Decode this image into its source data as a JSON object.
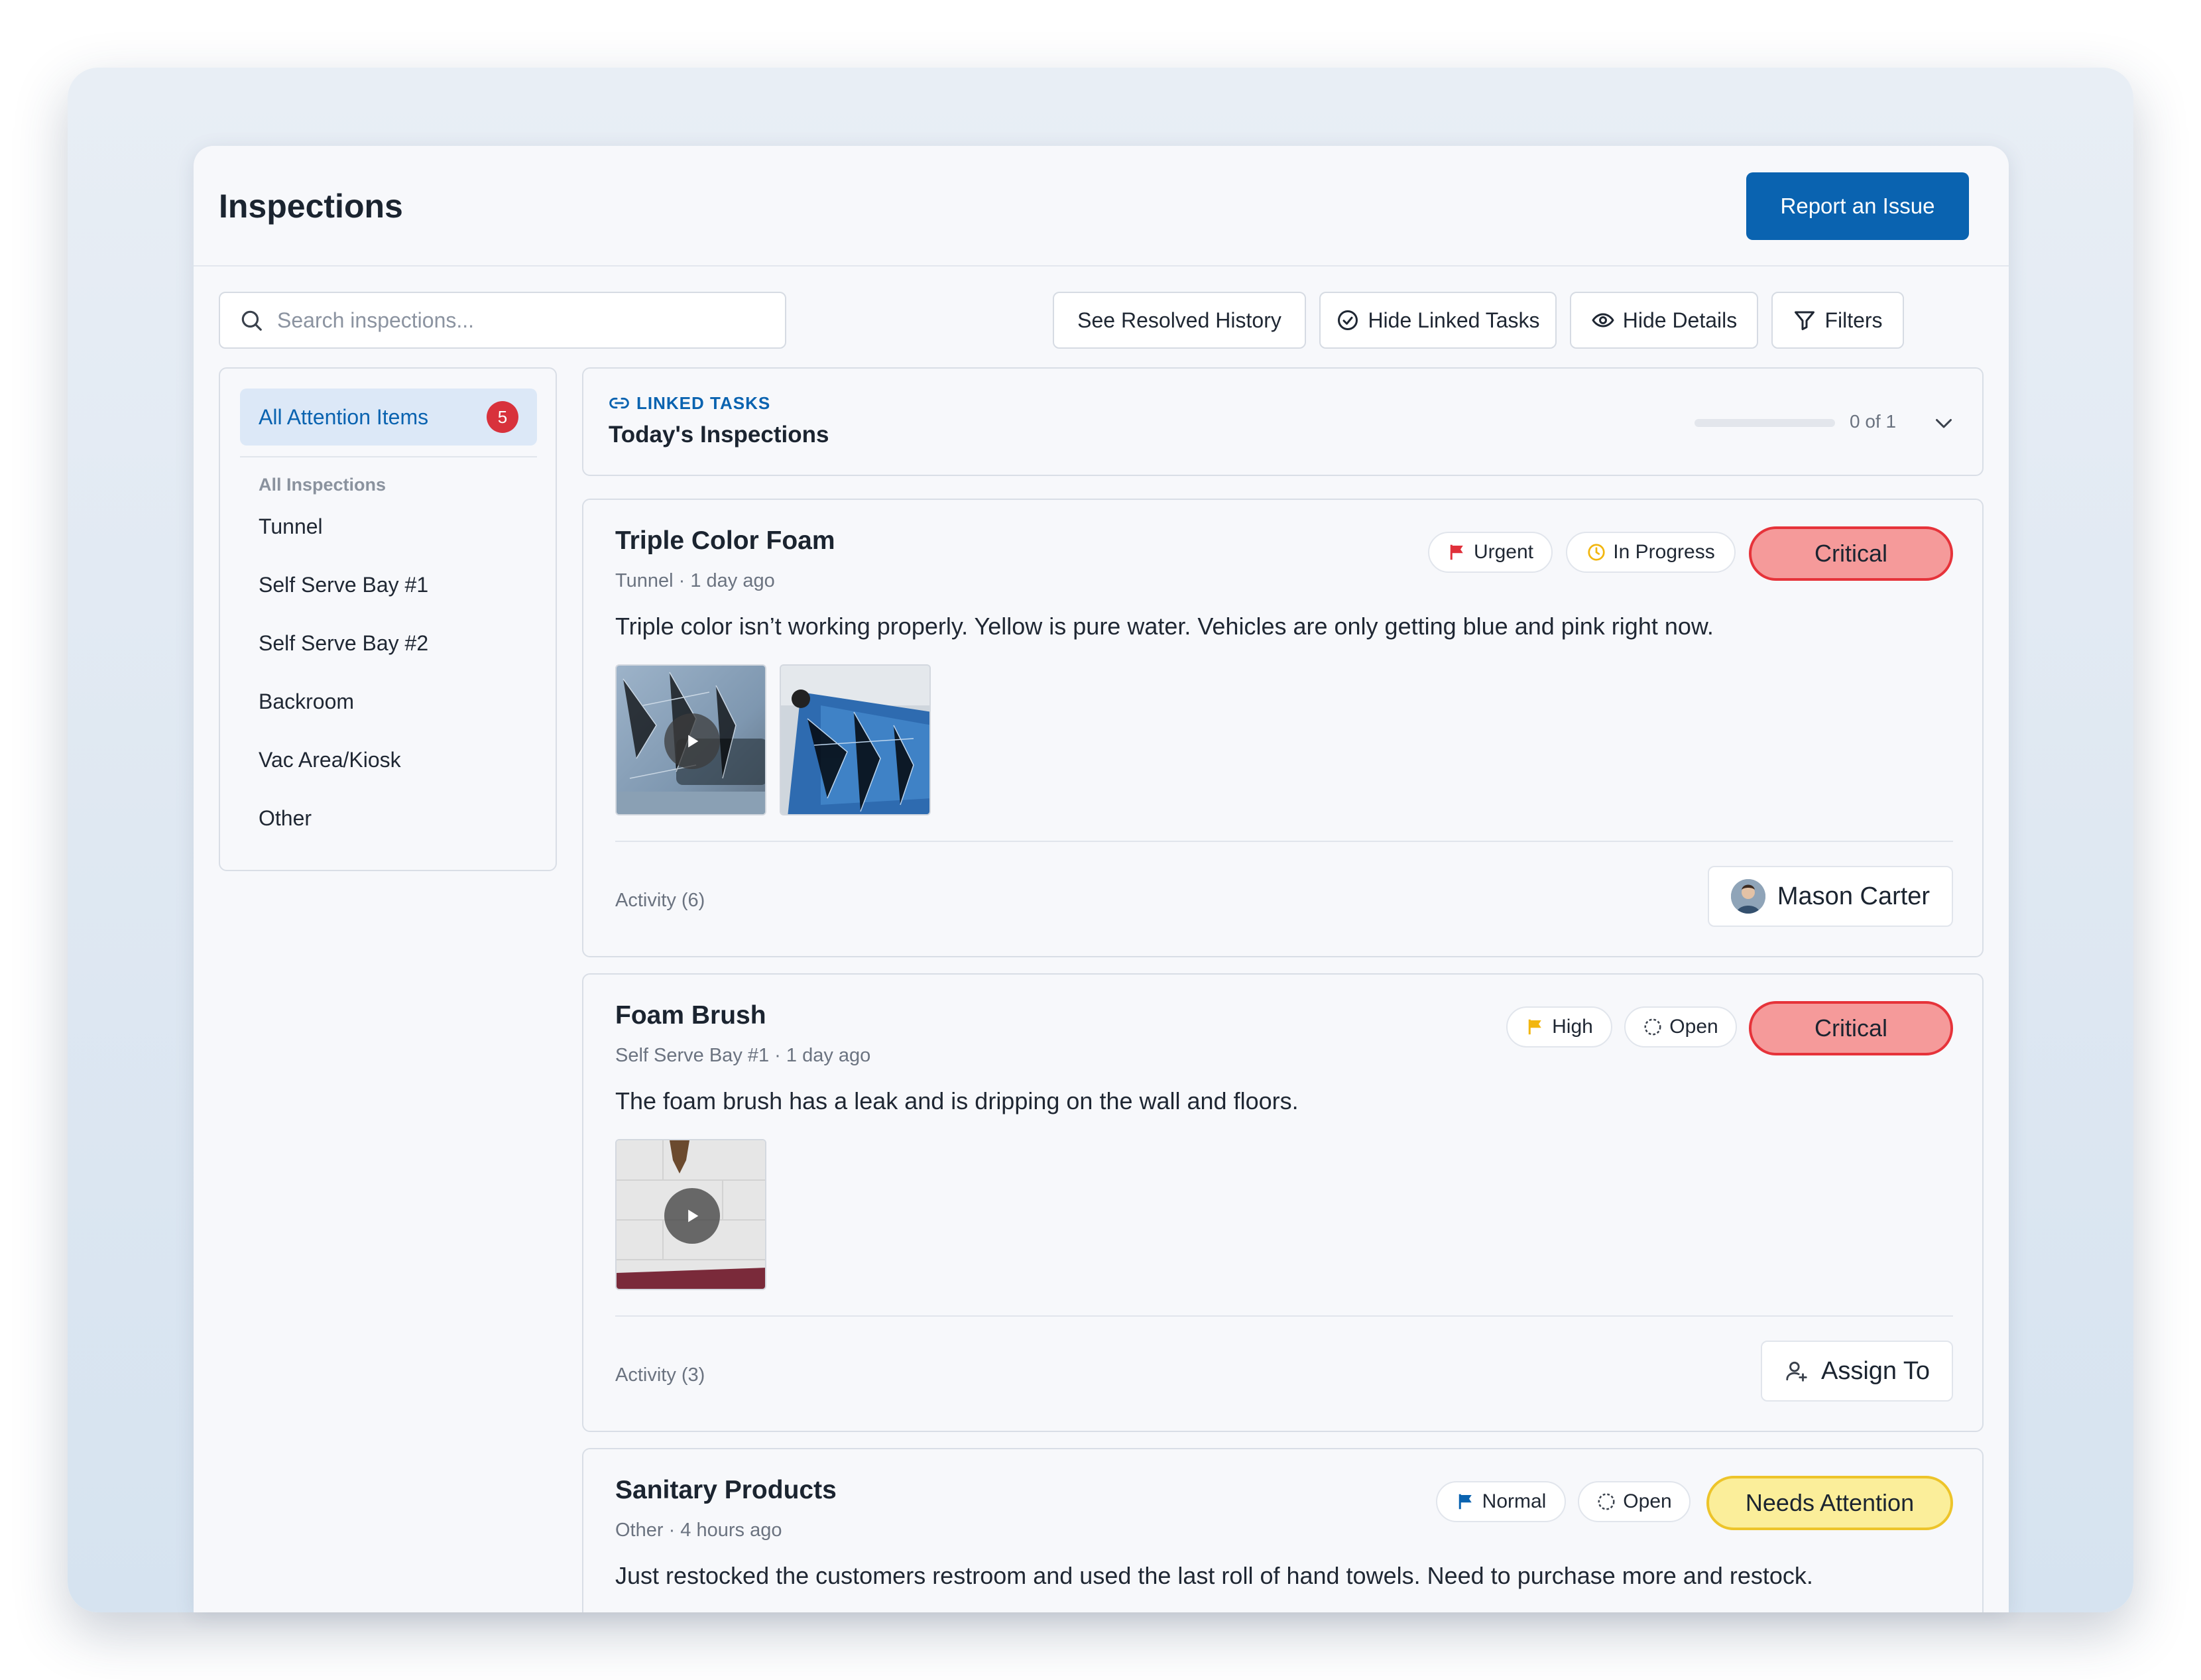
{
  "header": {
    "title": "Inspections",
    "report_button": "Report an Issue"
  },
  "toolbar": {
    "search_placeholder": "Search inspections...",
    "resolved_history": "See Resolved History",
    "hide_linked_tasks": "Hide Linked Tasks",
    "hide_details": "Hide Details",
    "filters": "Filters"
  },
  "sidebar": {
    "active_item": "All Attention Items",
    "active_count": "5",
    "section_label": "All Inspections",
    "items": [
      {
        "label": "Tunnel"
      },
      {
        "label": "Self Serve Bay #1"
      },
      {
        "label": "Self Serve Bay #2"
      },
      {
        "label": "Backroom"
      },
      {
        "label": "Vac Area/Kiosk"
      },
      {
        "label": "Other"
      }
    ]
  },
  "linked_tasks": {
    "label": "LINKED TASKS",
    "title": "Today's Inspections",
    "progress_text": "0 of 1",
    "progress_fraction": 0
  },
  "cards": [
    {
      "title": "Triple Color Foam",
      "subtitle": "Tunnel · 1 day ago",
      "description": "Triple color isn’t working properly. Yellow is pure water. Vehicles are only getting blue and pink right now.",
      "priority": "Urgent",
      "priority_color": "#e0303a",
      "state": "In Progress",
      "state_icon": "clock-icon",
      "severity": "Critical",
      "activity": "Activity (6)",
      "assignee": "Mason Carter"
    },
    {
      "title": "Foam Brush",
      "subtitle": "Self Serve Bay #1 · 1 day ago",
      "description": "The foam brush has a leak and is dripping on the wall and floors.",
      "priority": "High",
      "priority_color": "#f2b60f",
      "state": "Open",
      "state_icon": "dashed-circle-icon",
      "severity": "Critical",
      "activity": "Activity (3)",
      "assignee": "Assign To"
    },
    {
      "title": "Sanitary Products",
      "subtitle": "Other · 4 hours ago",
      "description": "Just restocked the customers restroom and used the last roll of hand towels. Need to purchase more and restock.",
      "priority": "Normal",
      "priority_color": "#0a63b0",
      "state": "Open",
      "state_icon": "dashed-circle-icon",
      "severity": "Needs Attention"
    }
  ],
  "colors": {
    "accent": "#0a63b0",
    "critical_fill": "#f59a9a",
    "critical_border": "#e6333a",
    "attention_fill": "#fbee9a",
    "attention_border": "#edc42a"
  }
}
